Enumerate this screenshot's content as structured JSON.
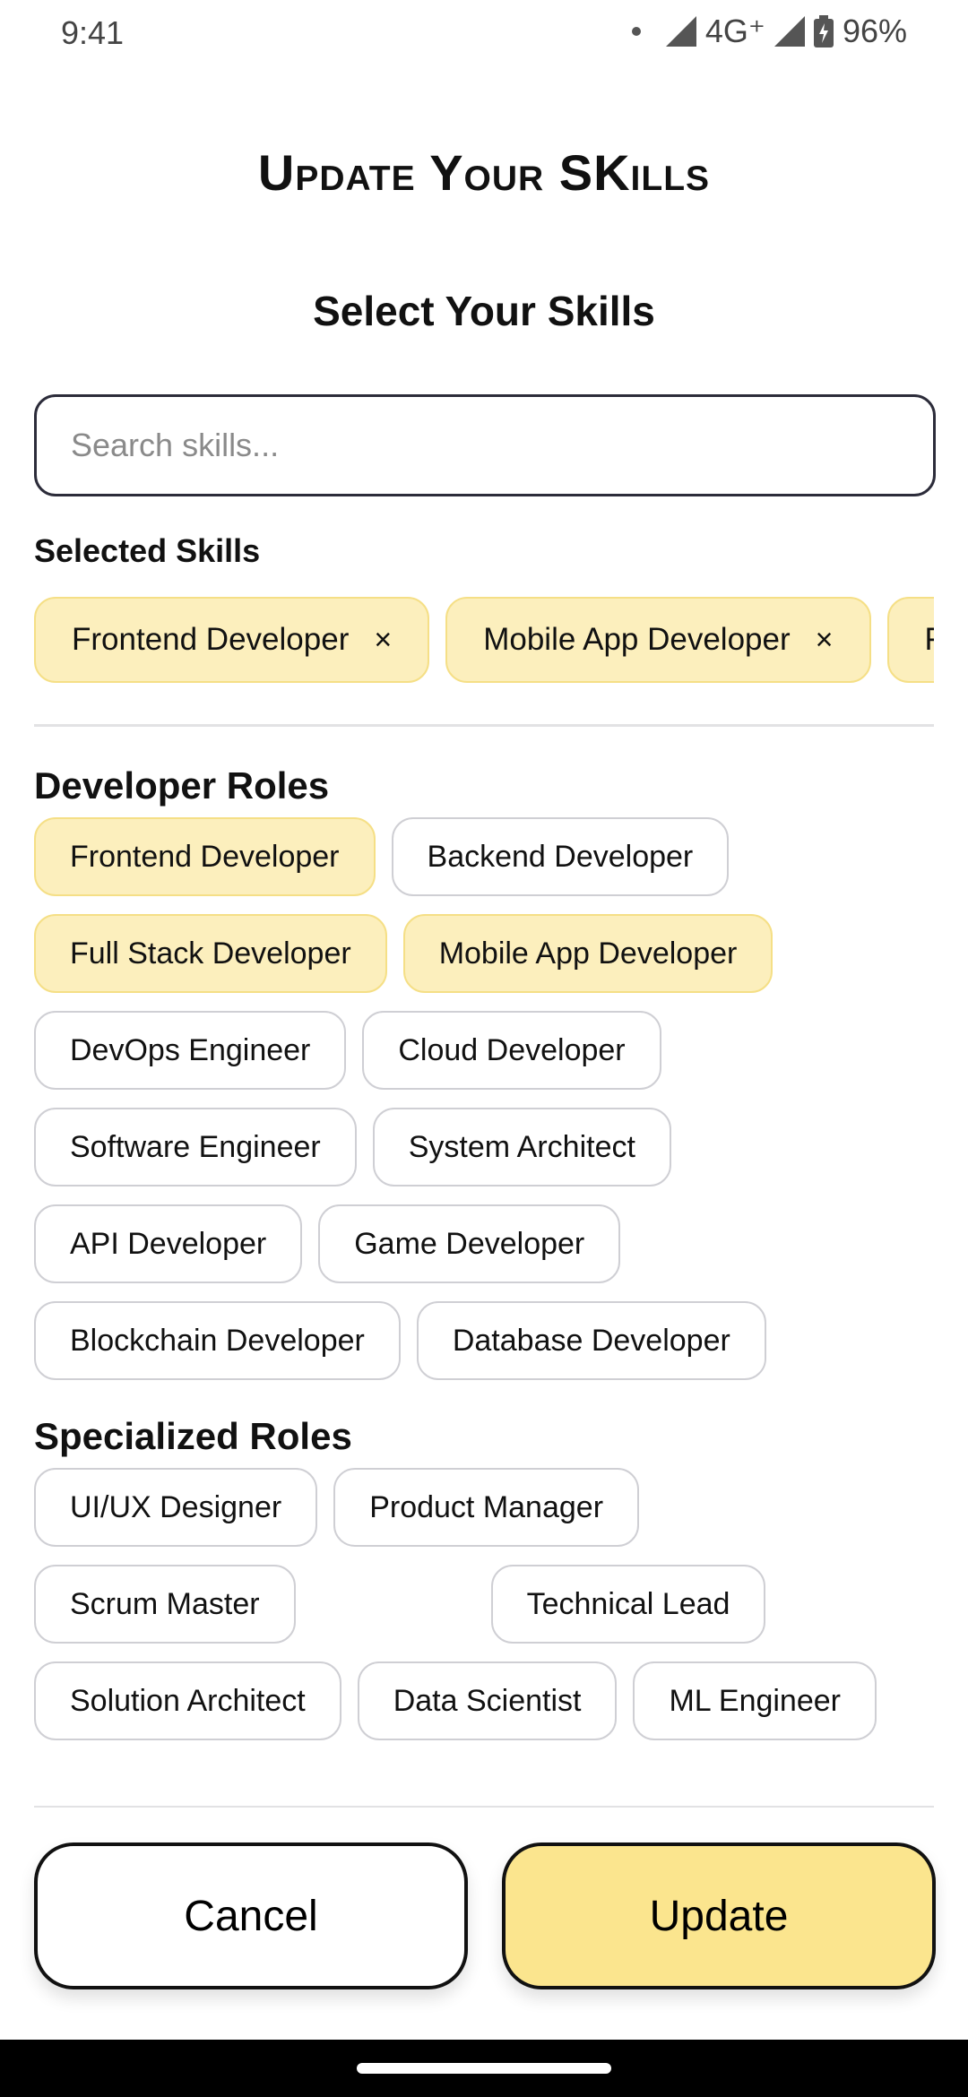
{
  "status_bar": {
    "time": "9:41",
    "network": "4G⁺",
    "battery": "96%"
  },
  "page_title": "Update Your SKills",
  "section_title": "Select Your Skills",
  "search": {
    "placeholder": "Search skills...",
    "value": ""
  },
  "selected_skills": {
    "label": "Selected Skills",
    "items": [
      "Frontend Developer",
      "Mobile App Developer",
      "Full Stack Developer"
    ],
    "remove_glyph": "×"
  },
  "groups": [
    {
      "title": "Developer Roles",
      "chips": [
        {
          "label": "Frontend Developer",
          "selected": true
        },
        {
          "label": "Backend Developer",
          "selected": false
        },
        {
          "label": "Full Stack Developer",
          "selected": true
        },
        {
          "label": "Mobile App Developer",
          "selected": true
        },
        {
          "label": "DevOps Engineer",
          "selected": false
        },
        {
          "label": "Cloud Developer",
          "selected": false
        },
        {
          "label": "Software Engineer",
          "selected": false
        },
        {
          "label": "System Architect",
          "selected": false
        },
        {
          "label": "API Developer",
          "selected": false
        },
        {
          "label": "Game Developer",
          "selected": false
        },
        {
          "label": "Blockchain Developer",
          "selected": false
        },
        {
          "label": "Database Developer",
          "selected": false
        }
      ]
    },
    {
      "title": "Specialized Roles",
      "chips": [
        {
          "label": "UI/UX Designer",
          "selected": false
        },
        {
          "label": "Product Manager",
          "selected": false
        },
        {
          "label": "Scrum Master",
          "selected": false
        },
        {
          "label": "Technical Lead",
          "selected": false
        },
        {
          "label": "Solution Architect",
          "selected": false
        },
        {
          "label": "Data Scientist",
          "selected": false
        },
        {
          "label": "ML Engineer",
          "selected": false
        }
      ]
    }
  ],
  "buttons": {
    "cancel": "Cancel",
    "update": "Update"
  },
  "colors": {
    "accent": "#fbe58e",
    "chip_selected_bg": "#fcefbd",
    "chip_selected_border": "#f5df86",
    "border": "#111111"
  }
}
